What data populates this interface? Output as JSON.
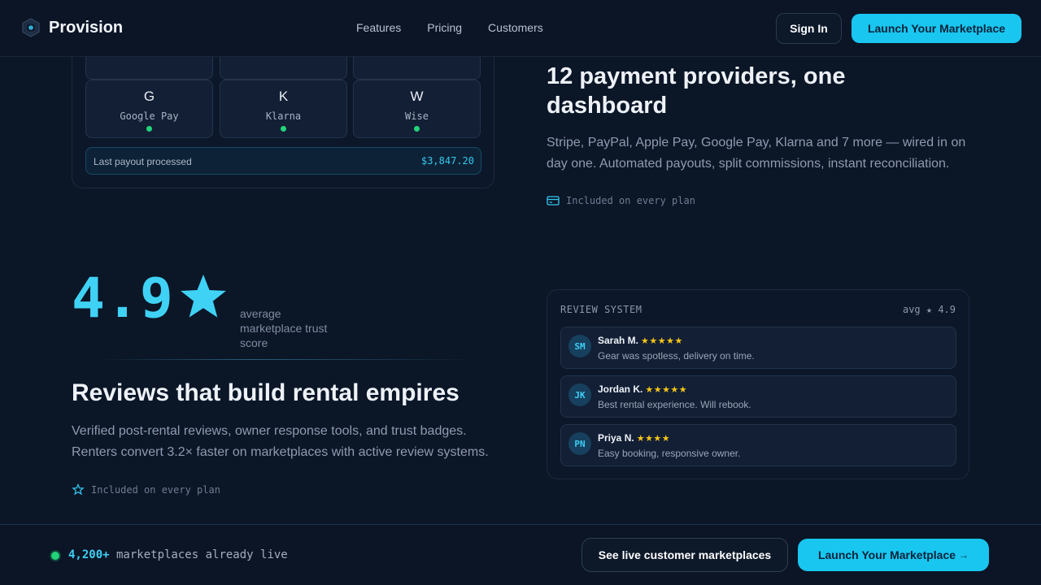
{
  "nav": {
    "brand": "Provision",
    "links": [
      "Features",
      "Pricing",
      "Customers"
    ],
    "sign_in": "Sign In",
    "launch": "Launch Your Marketplace"
  },
  "payments": {
    "providers": [
      {
        "letter": "G",
        "name": "Google Pay"
      },
      {
        "letter": "K",
        "name": "Klarna"
      },
      {
        "letter": "W",
        "name": "Wise"
      }
    ],
    "payout_label": "Last payout processed",
    "payout_value": "$3,847.20",
    "heading": "12 payment providers, one dashboard",
    "description": "Stripe, PayPal, Apple Pay, Google Pay, Klarna and 7 more — wired in on day one. Automated payouts, split commissions, instant reconciliation.",
    "included": "Included on every plan"
  },
  "rating": {
    "score": "4.9",
    "caption": "average marketplace trust score",
    "heading": "Reviews that build rental empires",
    "description": "Verified post-rental reviews, owner response tools, and trust badges. Renters convert 3.2× faster on marketplaces with active review systems.",
    "included": "Included on every plan"
  },
  "reviews": {
    "title": "REVIEW SYSTEM",
    "avg": "avg ★ 4.9",
    "items": [
      {
        "initials": "SM",
        "name": "Sarah M.",
        "stars": "★★★★★",
        "text": "Gear was spotless, delivery on time."
      },
      {
        "initials": "JK",
        "name": "Jordan K.",
        "stars": "★★★★★",
        "text": "Best rental experience. Will rebook."
      },
      {
        "initials": "PN",
        "name": "Priya N.",
        "stars": "★★★★",
        "text": "Easy booking, responsive owner."
      }
    ]
  },
  "footer_bar": {
    "count": "4,200+",
    "live_text": " marketplaces already live",
    "see_button": "See live customer marketplaces",
    "launch_button": "Launch Your Marketplace",
    "launch_arrow": "→"
  },
  "colors": {
    "accent": "#19c6f0",
    "background": "#0b1627",
    "live_green": "#22d37a",
    "star_yellow": "#f5c518"
  },
  "icons": {
    "brand": "cube-logo-icon",
    "payments_included": "credit-card-icon",
    "reviews_included": "star-outline-icon",
    "score": "star-icon",
    "live": "status-dot-icon"
  }
}
